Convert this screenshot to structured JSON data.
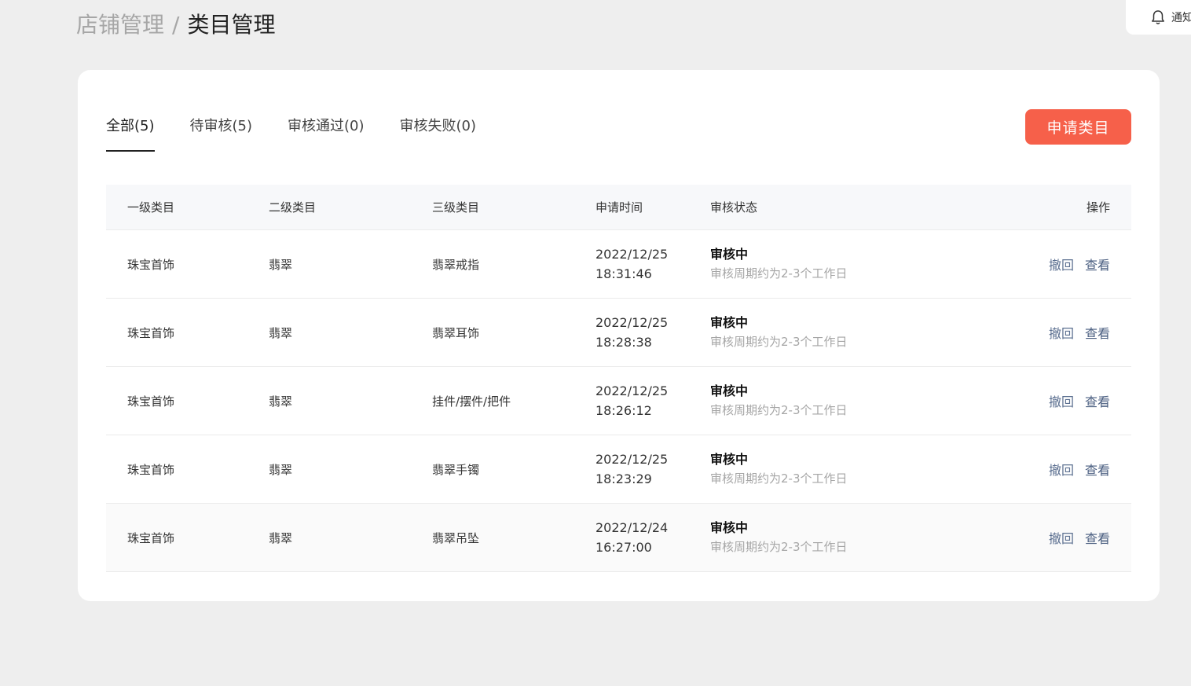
{
  "breadcrumb": {
    "parent": "店铺管理",
    "separator": "/",
    "current": "类目管理"
  },
  "notice": {
    "label": "通知",
    "icon": "bell-icon"
  },
  "tabs": [
    {
      "label": "全部(5)",
      "active": true
    },
    {
      "label": "待审核(5)",
      "active": false
    },
    {
      "label": "审核通过(0)",
      "active": false
    },
    {
      "label": "审核失败(0)",
      "active": false
    }
  ],
  "apply_button": {
    "label": "申请类目",
    "color": "#f6604a"
  },
  "table": {
    "headers": [
      "一级类目",
      "二级类目",
      "三级类目",
      "申请时间",
      "审核状态",
      "操作"
    ],
    "rows": [
      {
        "level1": "珠宝首饰",
        "level2": "翡翠",
        "level3": "翡翠戒指",
        "date": "2022/12/25",
        "time": "18:31:46",
        "status": "审核中",
        "status_note": "审核周期约为2-3个工作日",
        "revoke": "撤回",
        "view": "查看"
      },
      {
        "level1": "珠宝首饰",
        "level2": "翡翠",
        "level3": "翡翠耳饰",
        "date": "2022/12/25",
        "time": "18:28:38",
        "status": "审核中",
        "status_note": "审核周期约为2-3个工作日",
        "revoke": "撤回",
        "view": "查看"
      },
      {
        "level1": "珠宝首饰",
        "level2": "翡翠",
        "level3": "挂件/摆件/把件",
        "date": "2022/12/25",
        "time": "18:26:12",
        "status": "审核中",
        "status_note": "审核周期约为2-3个工作日",
        "revoke": "撤回",
        "view": "查看"
      },
      {
        "level1": "珠宝首饰",
        "level2": "翡翠",
        "level3": "翡翠手镯",
        "date": "2022/12/25",
        "time": "18:23:29",
        "status": "审核中",
        "status_note": "审核周期约为2-3个工作日",
        "revoke": "撤回",
        "view": "查看"
      },
      {
        "level1": "珠宝首饰",
        "level2": "翡翠",
        "level3": "翡翠吊坠",
        "date": "2022/12/24",
        "time": "16:27:00",
        "status": "审核中",
        "status_note": "审核周期约为2-3个工作日",
        "revoke": "撤回",
        "view": "查看"
      }
    ]
  }
}
